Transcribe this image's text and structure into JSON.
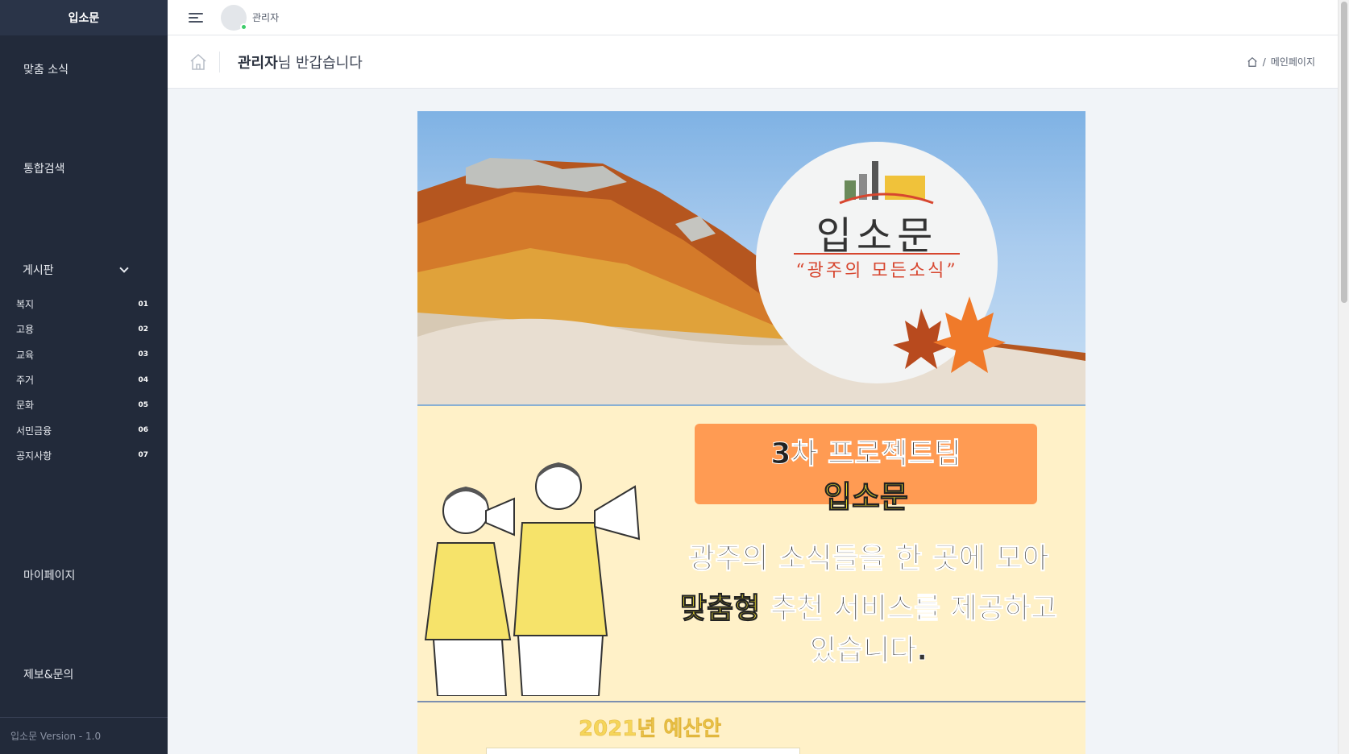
{
  "sidebar": {
    "brand": "입소문",
    "nav": {
      "custom_news": "맞춤 소식",
      "search": "통합검색",
      "board": "게시판",
      "mypage": "마이페이지",
      "report": "제보&문의"
    },
    "board_items": [
      {
        "label": "복지",
        "num": "01"
      },
      {
        "label": "고용",
        "num": "02"
      },
      {
        "label": "교육",
        "num": "03"
      },
      {
        "label": "주거",
        "num": "04"
      },
      {
        "label": "문화",
        "num": "05"
      },
      {
        "label": "서민금융",
        "num": "06"
      },
      {
        "label": "공지사항",
        "num": "07"
      }
    ],
    "footer": "입소문 Version - 1.0"
  },
  "topbar": {
    "user_name": "관리자"
  },
  "header": {
    "greeting_name": "관리자",
    "greeting_rest": "님 반갑습니다",
    "breadcrumb_sep": "/",
    "breadcrumb_current": "메인페이지"
  },
  "banner": {
    "hero_title": "입소문",
    "hero_subtitle": "“광주의 모든소식”",
    "team": "3차 프로젝트팀",
    "team_name": "입소문",
    "line1": "광주의 소식들을 한 곳에 모아",
    "line2_highlight": "맞춤형",
    "line2_rest": " 추천 서비스를 제공하고",
    "line3": "있습니다.",
    "year_text": "2021년 예산안"
  },
  "colors": {
    "sidebar_bg": "#222a3a",
    "accent_orange": "#ff9b53",
    "highlight_yellow": "#f6e52f",
    "online_green": "#3dcc6a"
  },
  "icons": [
    "hamburger-icon",
    "home-icon",
    "chevron-down-icon",
    "online-status-icon"
  ]
}
